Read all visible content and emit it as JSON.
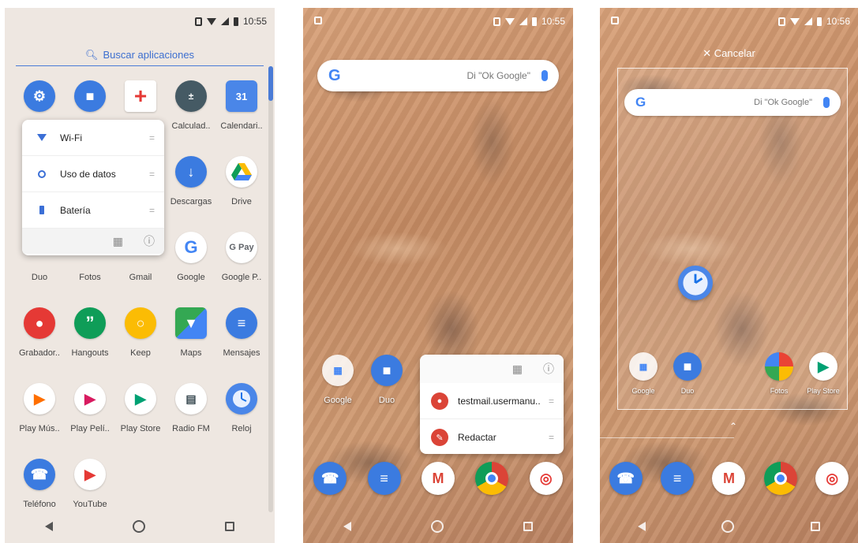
{
  "status": {
    "time_1": "10:55",
    "time_2": "10:55",
    "time_3": "10:56"
  },
  "drawer": {
    "search_label": "Buscar aplicaciones",
    "apps_row1": [
      "",
      "",
      "",
      "Calculad..",
      "Calendari.."
    ],
    "apps_row2_visible": [
      "Descargas",
      "Drive"
    ],
    "apps_row3": [
      "Duo",
      "Fotos",
      "Gmail",
      "Google",
      "Google P.."
    ],
    "apps_row4": [
      "Grabador..",
      "Hangouts",
      "Keep",
      "Maps",
      "Mensajes"
    ],
    "apps_row5": [
      "Play Mús..",
      "Play Pelí..",
      "Play Store",
      "Radio FM",
      "Reloj"
    ],
    "apps_row6": [
      "Teléfono",
      "YouTube"
    ],
    "calendar_day": "31",
    "gpay_text": "G Pay"
  },
  "settings_popup": {
    "items": [
      "Wi-Fi",
      "Uso de datos",
      "Batería"
    ],
    "drag_glyph": "="
  },
  "home": {
    "google_hint": "Di \"Ok Google\"",
    "folder_label": "Google",
    "duo_label": "Duo"
  },
  "gmail_popup": {
    "items": [
      "testmail.usermanu..",
      "Redactar"
    ]
  },
  "widget": {
    "cancel_label": "Cancelar",
    "google_hint": "Di \"Ok Google\"",
    "labels": [
      "Google",
      "Duo",
      "Fotos",
      "Play Store"
    ]
  }
}
